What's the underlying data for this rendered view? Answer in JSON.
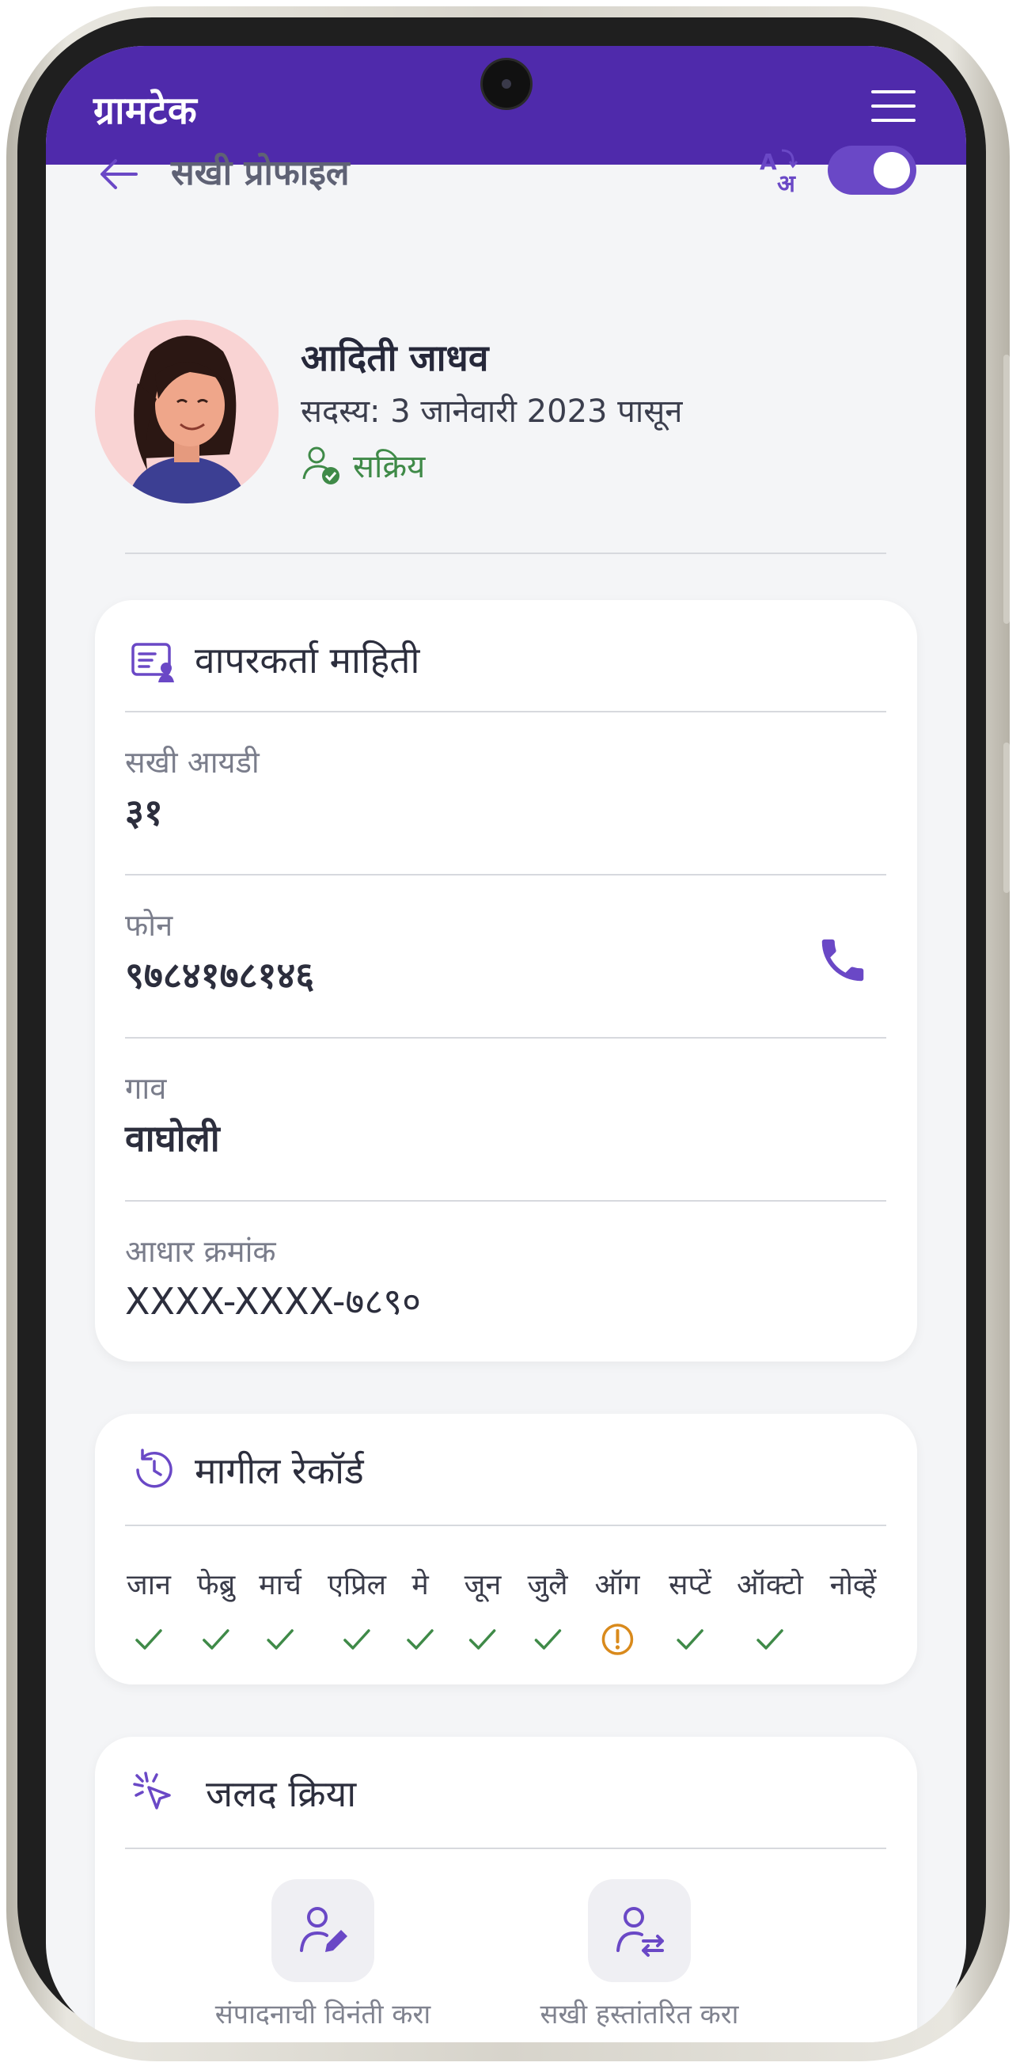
{
  "app": {
    "brand": "ग्रामटेक"
  },
  "header": {
    "title": "सखी प्रोफाइल"
  },
  "profile": {
    "name": "आदिती जाधव",
    "member_since": "सदस्य: 3 जानेवारी 2023 पासून",
    "status": "सक्रिय"
  },
  "user_info": {
    "title": "वापरकर्ता माहिती",
    "fields": [
      {
        "label": "सखी आयडी",
        "value": "३१"
      },
      {
        "label": "फोन",
        "value": "९७८४१७८१४६"
      },
      {
        "label": "गाव",
        "value": "वाघोली"
      },
      {
        "label": "आधार क्रमांक",
        "value": "XXXX-XXXX-७८९०"
      }
    ]
  },
  "history": {
    "title": "मागील रेकॉर्ड",
    "months": [
      {
        "label": "जान",
        "status": "done"
      },
      {
        "label": "फेब्रु",
        "status": "done"
      },
      {
        "label": "मार्च",
        "status": "done"
      },
      {
        "label": "एप्रिल",
        "status": "done"
      },
      {
        "label": "मे",
        "status": "done"
      },
      {
        "label": "जून",
        "status": "done"
      },
      {
        "label": "जुलै",
        "status": "done"
      },
      {
        "label": "ऑग",
        "status": "warning"
      },
      {
        "label": "सप्टें",
        "status": "done"
      },
      {
        "label": "ऑक्टो",
        "status": "done"
      },
      {
        "label": "नोव्हें",
        "status": "none"
      }
    ]
  },
  "quick_actions": {
    "title": "जलद क्रिया",
    "actions": [
      {
        "label": "संपादनाची विनंती करा",
        "icon": "user-edit-icon"
      },
      {
        "label": "सखी हस्तांतरित करा",
        "icon": "user-transfer-icon"
      }
    ]
  },
  "colors": {
    "brand": "#4f2aab",
    "accent": "#6a48c6",
    "success": "#3f8a48",
    "warning": "#d98a1c"
  }
}
